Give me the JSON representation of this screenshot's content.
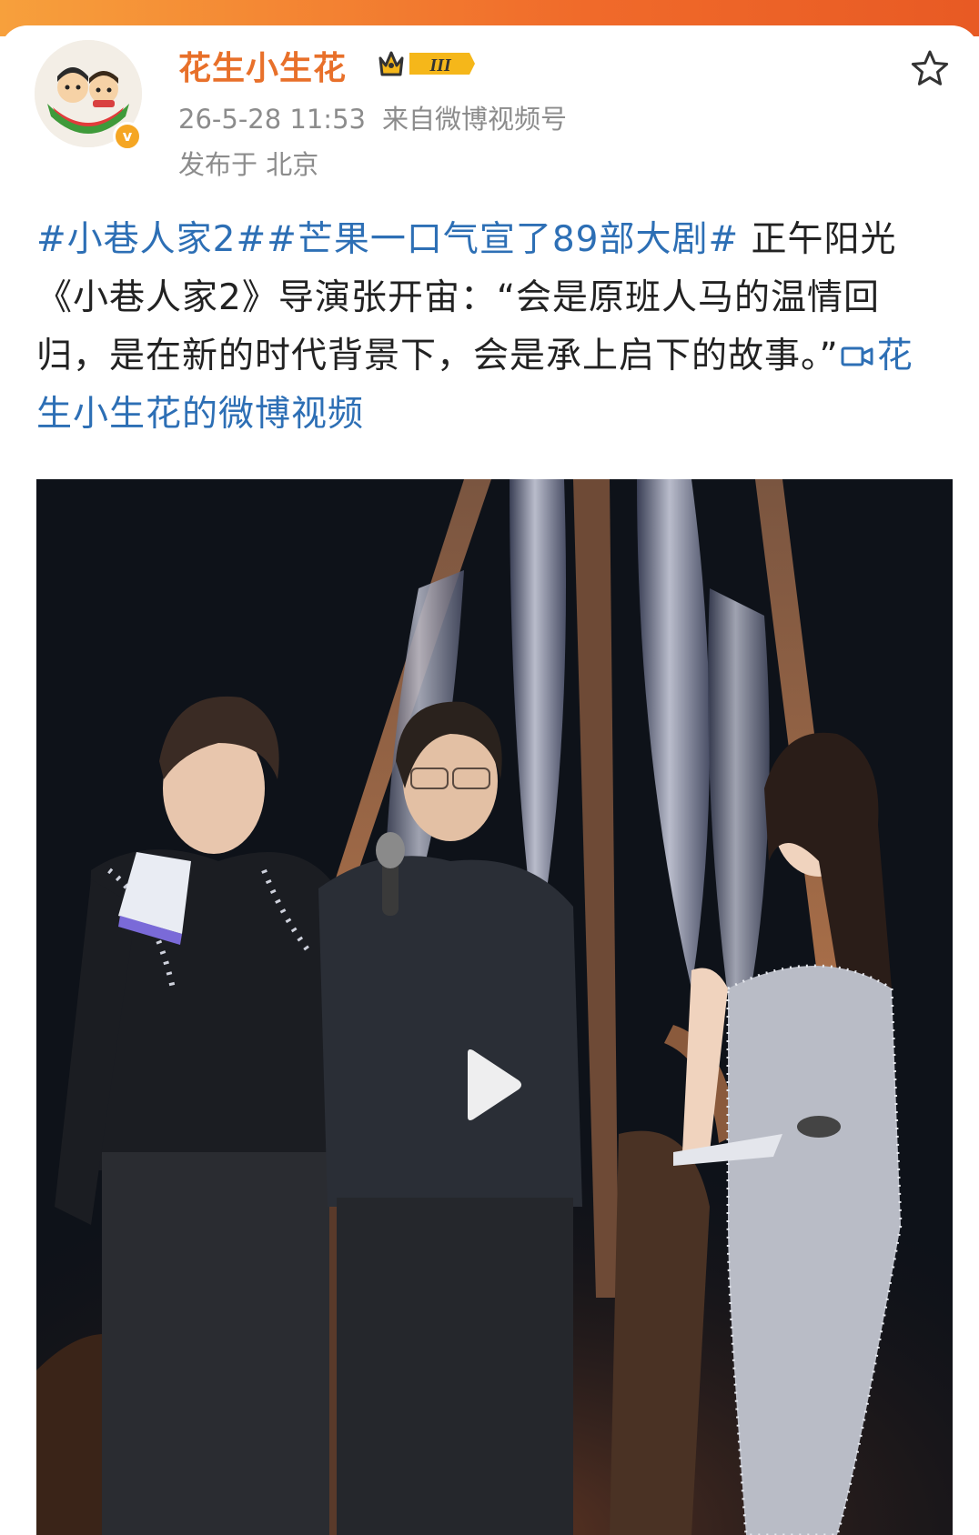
{
  "post": {
    "username": "花生小生花",
    "vip_level": "III",
    "timestamp": "26-5-28 11:53",
    "source": "来自微博视频号",
    "location": "发布于 北京",
    "tag1": "#小巷人家2#",
    "tag2": "#芒果一口气宣了89部大剧#",
    "body": " 正午阳光《小巷人家2》导演张开宙：“会是原班人马的温情回归，是在新的时代背景下，会是承上启下的故事。”",
    "video_link": "花生小生花的微博视频"
  },
  "colors": {
    "username": "#e8702a",
    "link": "#2d6fb5",
    "meta": "#8c8c8c",
    "header_strip": "#f06a2a"
  },
  "icons": [
    "avatar",
    "verified-badge-icon",
    "vip-crown-icon",
    "star-icon",
    "video-icon",
    "play-icon"
  ]
}
